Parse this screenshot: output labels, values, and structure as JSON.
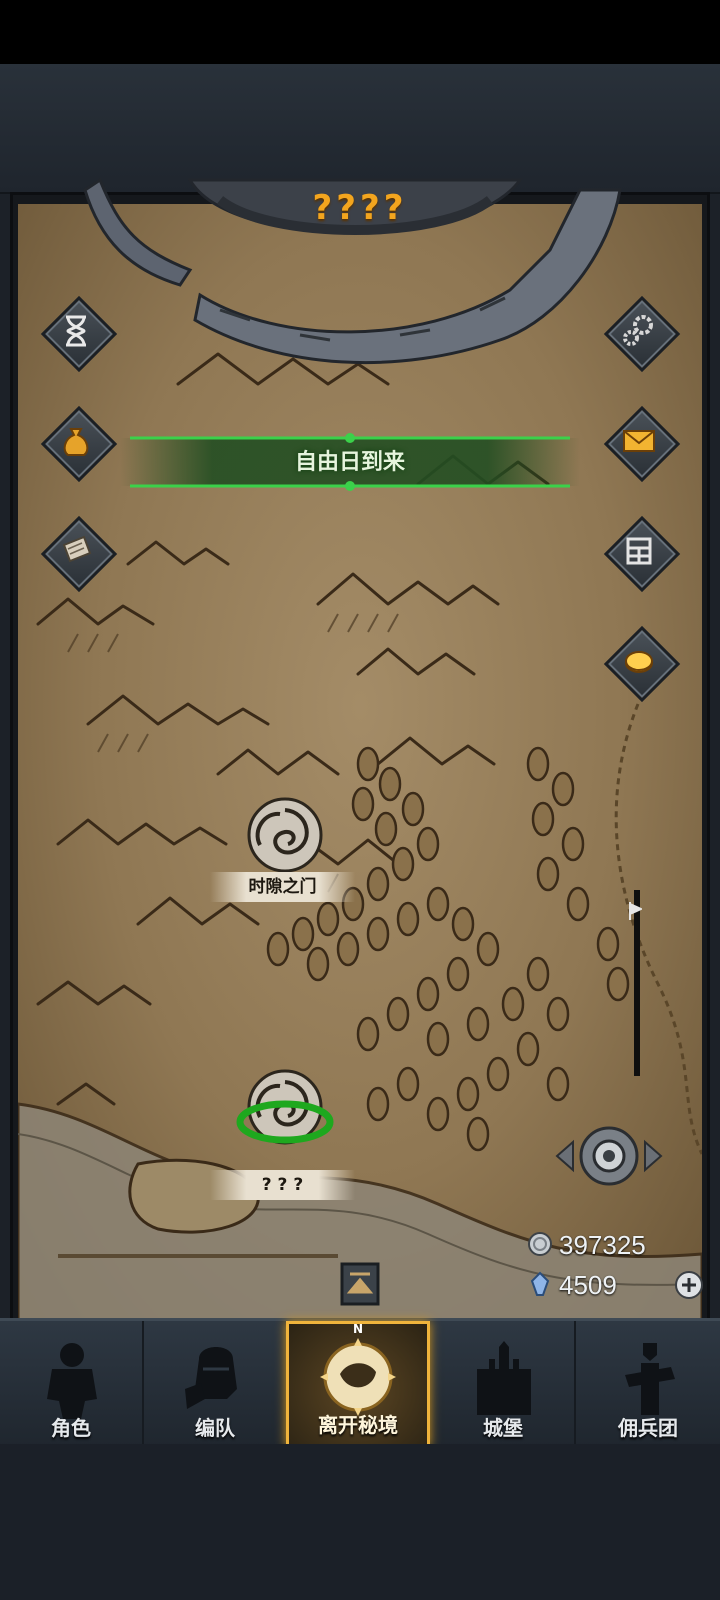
{
  "header": {
    "title": "????"
  },
  "left_buttons": [
    {
      "name": "hourglass",
      "icon": "hourglass-icon"
    },
    {
      "name": "bag",
      "icon": "money-bag-icon"
    },
    {
      "name": "scroll",
      "icon": "scroll-icon"
    }
  ],
  "right_buttons": [
    {
      "name": "settings",
      "icon": "gear-icon"
    },
    {
      "name": "mail",
      "icon": "envelope-icon"
    },
    {
      "name": "shop",
      "icon": "stall-icon"
    },
    {
      "name": "coin",
      "icon": "coin-icon"
    }
  ],
  "banner": {
    "text": "自由日到来"
  },
  "locations": [
    {
      "label": "时隙之门"
    },
    {
      "label": "? ? ?"
    }
  ],
  "currency": {
    "silver": "397325",
    "crystal": "4509"
  },
  "nav": {
    "tabs": [
      {
        "label": "角色"
      },
      {
        "label": "编队"
      },
      {
        "label": "离开秘境",
        "compass": "N"
      },
      {
        "label": "城堡"
      },
      {
        "label": "佣兵团"
      }
    ],
    "active_index": 2
  },
  "colors": {
    "title": "#f3a51e",
    "banner_glow": "#3bd14a",
    "parchment": "#a48c67",
    "active_tab_border": "#f0b43c"
  }
}
